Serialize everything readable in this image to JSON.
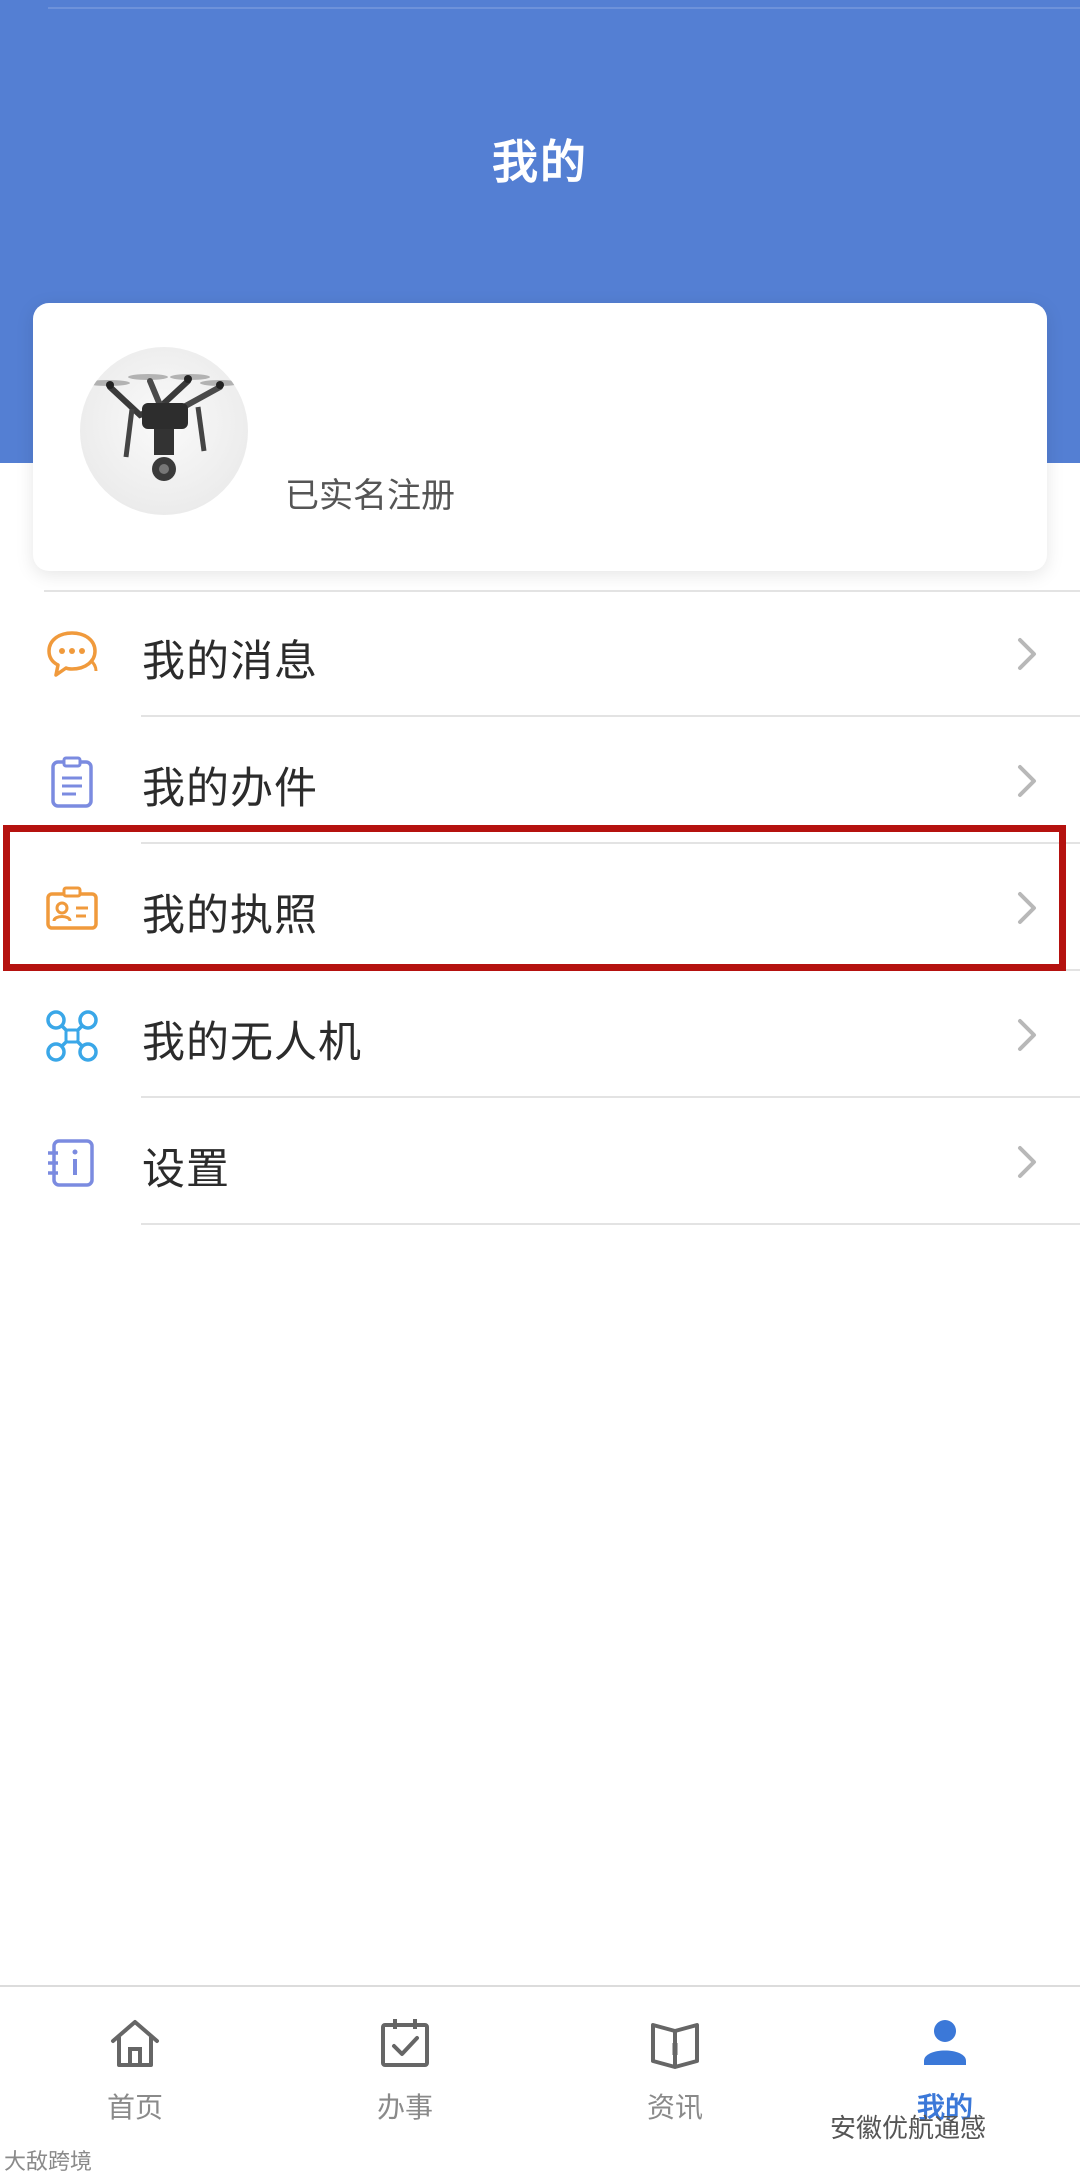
{
  "header": {
    "title": "我的"
  },
  "profile": {
    "status": "已实名注册"
  },
  "menu": {
    "items": [
      {
        "label": "我的消息",
        "icon": "chat-bubble-icon",
        "color": "#f09a3c"
      },
      {
        "label": "我的办件",
        "icon": "clipboard-icon",
        "color": "#7b8be0"
      },
      {
        "label": "我的执照",
        "icon": "id-card-icon",
        "color": "#f09a3c"
      },
      {
        "label": "我的无人机",
        "icon": "drone-icon",
        "color": "#3aa7e8"
      },
      {
        "label": "设置",
        "icon": "settings-info-icon",
        "color": "#7b8be0"
      }
    ]
  },
  "tabbar": {
    "items": [
      {
        "label": "首页",
        "icon": "home-icon"
      },
      {
        "label": "办事",
        "icon": "calendar-check-icon"
      },
      {
        "label": "资讯",
        "icon": "book-icon"
      },
      {
        "label": "我的",
        "icon": "user-icon",
        "active": true
      }
    ]
  },
  "watermark": {
    "right": "安徽优航通感",
    "left": "大敌跨境"
  },
  "colors": {
    "header_bg": "#547fd3",
    "highlight": "#b5120f",
    "active_tab": "#3b78d8"
  }
}
